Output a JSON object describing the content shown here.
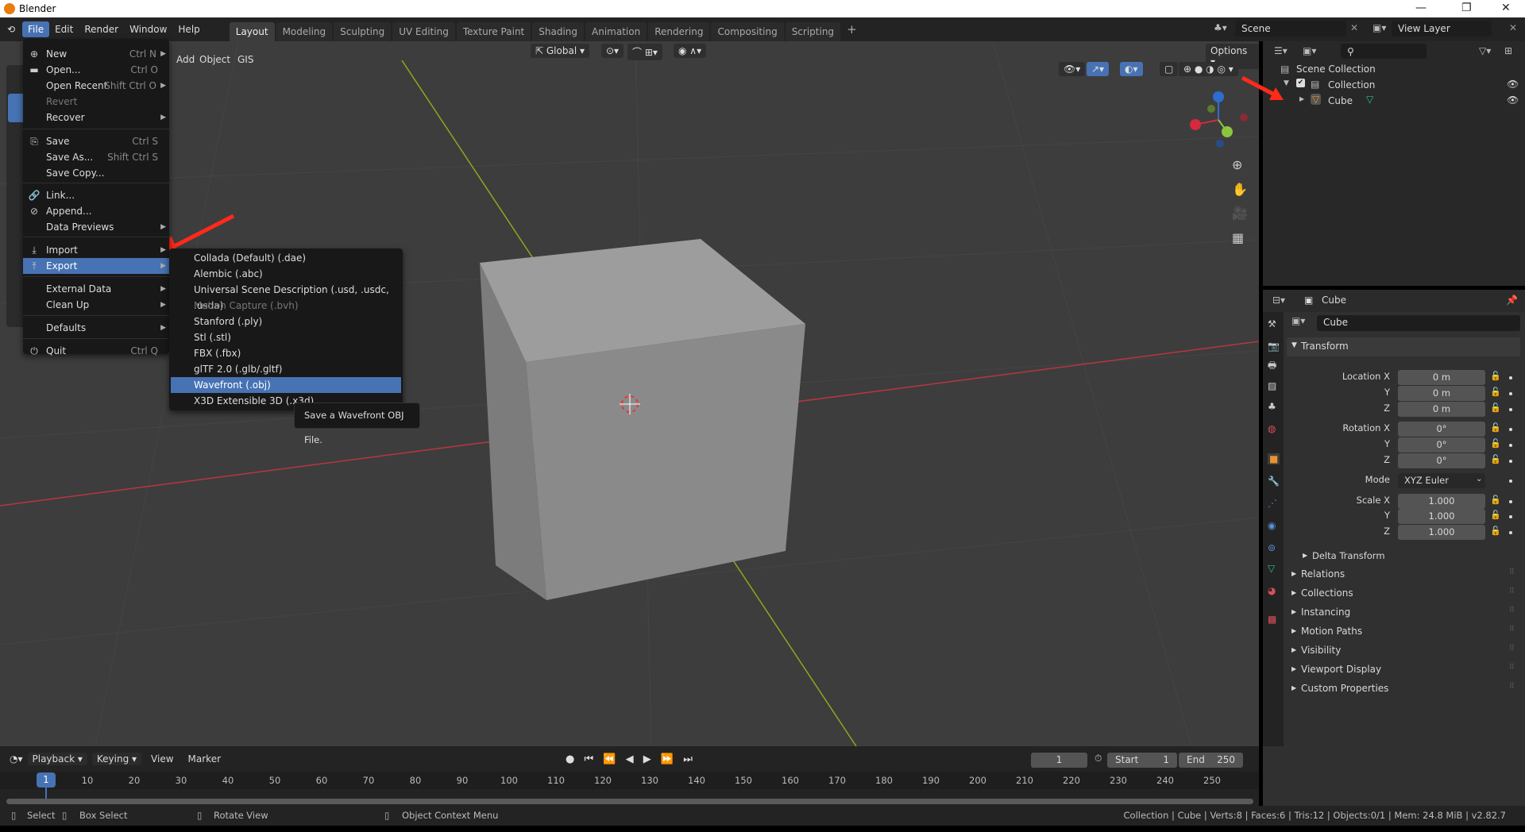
{
  "window": {
    "title": "Blender"
  },
  "menubar": {
    "items": [
      "File",
      "Edit",
      "Render",
      "Window",
      "Help"
    ],
    "active": "File"
  },
  "workspaces": {
    "tabs": [
      "Layout",
      "Modeling",
      "Sculpting",
      "UV Editing",
      "Texture Paint",
      "Shading",
      "Animation",
      "Rendering",
      "Compositing",
      "Scripting"
    ],
    "active": "Layout",
    "add": "+"
  },
  "scene": {
    "label": "Scene",
    "view_layer": "View Layer"
  },
  "viewport": {
    "header": {
      "orientation": "Global",
      "options": "Options",
      "menus": [
        "Add",
        "Object",
        "GIS"
      ]
    },
    "gizmo": {
      "x": "X",
      "y": "Y",
      "z": "Z"
    }
  },
  "file_menu": {
    "items": [
      {
        "label": "New",
        "shortcut": "Ctrl N",
        "sub": true,
        "icon": "new-file-icon"
      },
      {
        "label": "Open...",
        "shortcut": "Ctrl O",
        "icon": "folder-icon"
      },
      {
        "label": "Open Recent",
        "shortcut": "Shift Ctrl O",
        "sub": true
      },
      {
        "label": "Revert",
        "disabled": true
      },
      {
        "label": "Recover",
        "sub": true
      },
      {
        "label": "Save",
        "shortcut": "Ctrl S",
        "icon": "save-icon"
      },
      {
        "label": "Save As...",
        "shortcut": "Shift Ctrl S"
      },
      {
        "label": "Save Copy..."
      },
      {
        "label": "Link...",
        "icon": "link-icon"
      },
      {
        "label": "Append...",
        "icon": "append-icon"
      },
      {
        "label": "Data Previews",
        "sub": true
      },
      {
        "label": "Import",
        "sub": true,
        "icon": "import-icon"
      },
      {
        "label": "Export",
        "sub": true,
        "icon": "export-icon",
        "highlight": true
      },
      {
        "label": "External Data",
        "sub": true
      },
      {
        "label": "Clean Up",
        "sub": true
      },
      {
        "label": "Defaults",
        "sub": true
      },
      {
        "label": "Quit",
        "shortcut": "Ctrl Q",
        "icon": "power-icon"
      }
    ]
  },
  "export_menu": {
    "items": [
      {
        "label": "Collada (Default) (.dae)"
      },
      {
        "label": "Alembic (.abc)"
      },
      {
        "label": "Universal Scene Description (.usd, .usdc, .usda)"
      },
      {
        "label": "Motion Capture (.bvh)",
        "disabled": true
      },
      {
        "label": "Stanford (.ply)"
      },
      {
        "label": "Stl (.stl)"
      },
      {
        "label": "FBX (.fbx)"
      },
      {
        "label": "glTF 2.0 (.glb/.gltf)"
      },
      {
        "label": "Wavefront (.obj)",
        "highlight": true
      },
      {
        "label": "X3D Extensible 3D (.x3d)"
      }
    ]
  },
  "tooltip": "Save a Wavefront OBJ File.",
  "outliner": {
    "scene_collection": "Scene Collection",
    "collection": "Collection",
    "object": "Cube"
  },
  "properties": {
    "object_name": "Cube",
    "object_field": "Cube",
    "transform": {
      "title": "Transform",
      "rows": [
        {
          "label": "Location X",
          "value": "0 m"
        },
        {
          "label": "Y",
          "value": "0 m"
        },
        {
          "label": "Z",
          "value": "0 m"
        },
        {
          "label": "Rotation X",
          "value": "0°"
        },
        {
          "label": "Y",
          "value": "0°"
        },
        {
          "label": "Z",
          "value": "0°"
        },
        {
          "label": "Mode",
          "value": "XYZ Euler",
          "dropdown": true
        },
        {
          "label": "Scale X",
          "value": "1.000"
        },
        {
          "label": "Y",
          "value": "1.000"
        },
        {
          "label": "Z",
          "value": "1.000"
        }
      ],
      "delta": "Delta Transform"
    },
    "panels": [
      "Relations",
      "Collections",
      "Instancing",
      "Motion Paths",
      "Visibility",
      "Viewport Display",
      "Custom Properties"
    ]
  },
  "timeline": {
    "menus": [
      "Playback",
      "Keying",
      "View",
      "Marker"
    ],
    "current_frame": "1",
    "start_label": "Start",
    "start": "1",
    "end_label": "End",
    "end": "250",
    "ticks": [
      "10",
      "20",
      "30",
      "40",
      "50",
      "60",
      "70",
      "80",
      "90",
      "100",
      "110",
      "120",
      "130",
      "140",
      "150",
      "160",
      "170",
      "180",
      "190",
      "200",
      "210",
      "220",
      "230",
      "240",
      "250"
    ]
  },
  "statusbar": {
    "hints": [
      "Select",
      "Box Select",
      "Rotate View",
      "Object Context Menu"
    ],
    "stats": "Collection | Cube | Verts:8 | Faces:6 | Tris:12 | Objects:0/1 | Mem: 24.8 MiB | v2.82.7"
  },
  "colors": {
    "accent": "#4772b3",
    "annotation_arrow": "#ff2a1a",
    "axis_x": "#b5383f",
    "axis_y": "#8ea61c"
  }
}
